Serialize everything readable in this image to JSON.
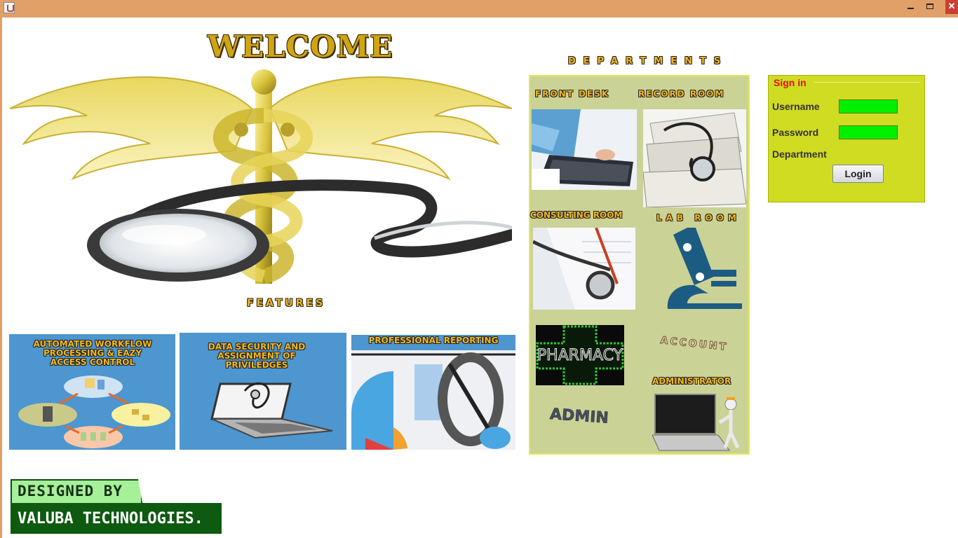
{
  "window": {
    "minimize_glyph": "",
    "maximize_glyph": "",
    "close_glyph": "✕"
  },
  "header": {
    "welcome": "WELCOME",
    "features": "FEATURES",
    "departments": "DEPARTMENTS"
  },
  "features": [
    {
      "title": "AUTOMATED WORKFLOW\nPROCESSING & EAZY\nACCESS CONTROL"
    },
    {
      "title": "DATA SECURITY AND\nASSIGNMENT OF\nPRIVILEDGES"
    },
    {
      "title": "PROFESSIONAL REPORTING"
    }
  ],
  "departments": {
    "front_desk": "FRONT DESK",
    "record_room": "RECORD ROOM",
    "consulting_room": "CONSULTING ROOM",
    "lab_room": "LAB ROOM",
    "pharmacy": "PHARMACY",
    "account": "ACCOUNT",
    "administrator": "ADMINISTRATOR",
    "admin": "ADMIN"
  },
  "signin": {
    "legend": "Sign in",
    "username_label": "Username",
    "username_value": "",
    "password_label": "Password",
    "password_value": "",
    "department_label": "Department",
    "login_label": "Login"
  },
  "footer": {
    "designed_by": "DESIGNED BY",
    "company": "VALUBA TECHNOLOGIES."
  },
  "colors": {
    "titlebar": "#e0a068",
    "accent_gold": "#f4b81e",
    "dept_panel": "#cbd296",
    "signin_panel": "#cfdc22",
    "input_fill": "#00f000",
    "tile_blue": "#4d96cf",
    "legend_red": "#e01010",
    "footer_green": "#0e5a10"
  }
}
